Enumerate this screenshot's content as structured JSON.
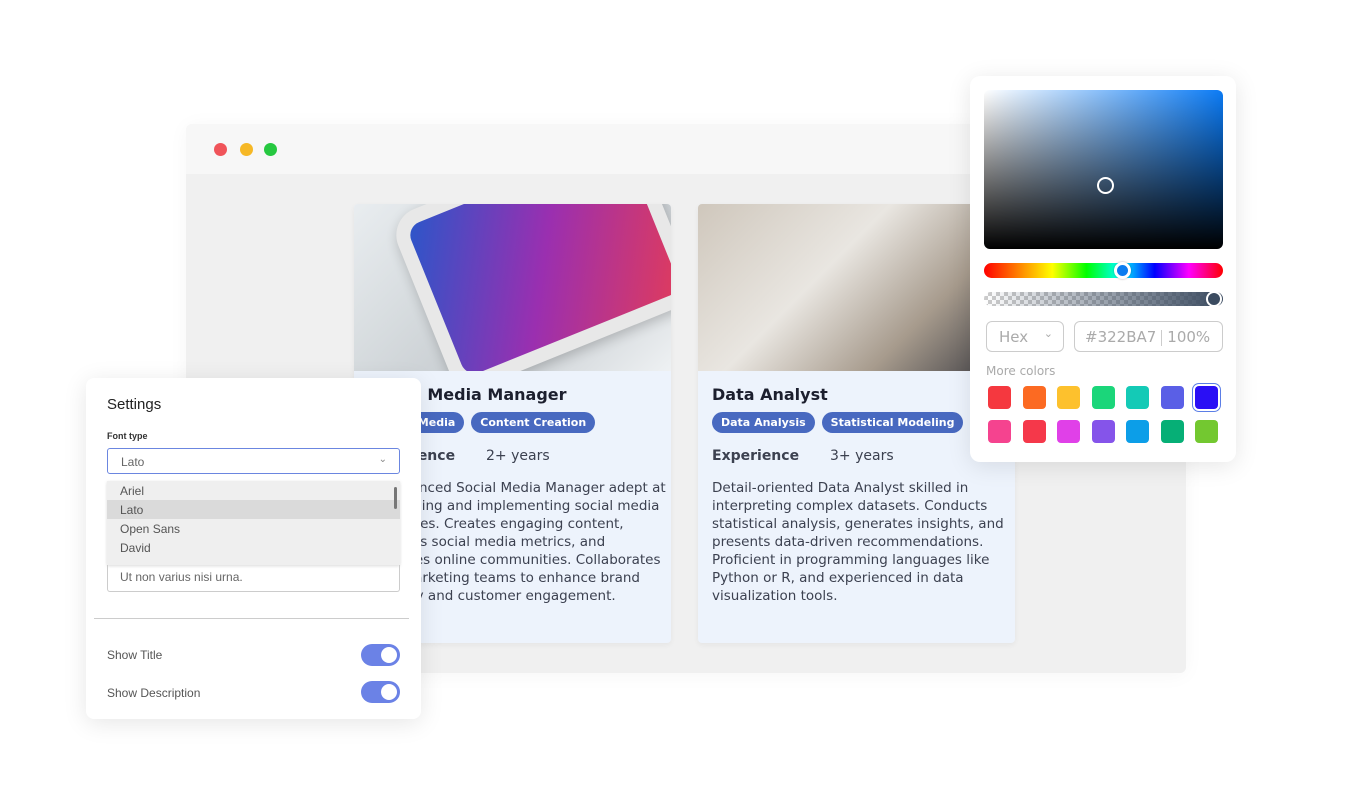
{
  "window": {
    "controls": [
      {
        "name": "close",
        "color": "#f0545a"
      },
      {
        "name": "minimize",
        "color": "#f6b826"
      },
      {
        "name": "maximize",
        "color": "#26c840"
      }
    ]
  },
  "cards": [
    {
      "title": "Social Media Manager",
      "tags": [
        "Social Media",
        "Content Creation"
      ],
      "experience_label": "Experience",
      "experience_value": "2+ years",
      "description": "Experienced Social Media Manager adept at developing and implementing social media strategies. Creates engaging content, analyzes social media metrics, and manages online communities. Collaborates with marketing teams to enhance brand visibility and customer engagement.",
      "image": "smartphone-apps-photo"
    },
    {
      "title": "Data Analyst",
      "tags": [
        "Data Analysis",
        "Statistical Modeling"
      ],
      "experience_label": "Experience",
      "experience_value": "3+ years",
      "description": "Detail-oriented Data Analyst skilled in interpreting complex datasets. Conducts statistical analysis, generates insights, and presents data-driven recommendations. Proficient in programming languages like Python or R, and experienced in data visualization tools.",
      "image": "business-charts-photo"
    }
  ],
  "settings": {
    "title": "Settings",
    "font_label": "Font type",
    "font_value": "Lato",
    "font_options": [
      "Ariel",
      "Lato",
      "Open Sans",
      "David"
    ],
    "textarea_value": "Ut non varius nisi urna.",
    "show_title_label": "Show Title",
    "show_title": true,
    "show_description_label": "Show Description",
    "show_description": true
  },
  "picker": {
    "format": "Hex",
    "hex": "#322BA7",
    "opacity": "100%",
    "more_colors_label": "More colors",
    "swatches": [
      "#f5383f",
      "#fc6a22",
      "#fdc12d",
      "#1bd67a",
      "#14cab6",
      "#5a5fe6",
      "#2a0ff5",
      "#f5438f",
      "#f5384a",
      "#e040e8",
      "#8554ea",
      "#0c9ee8",
      "#06af76",
      "#73c830"
    ],
    "active_swatch": "#2a0ff5"
  }
}
